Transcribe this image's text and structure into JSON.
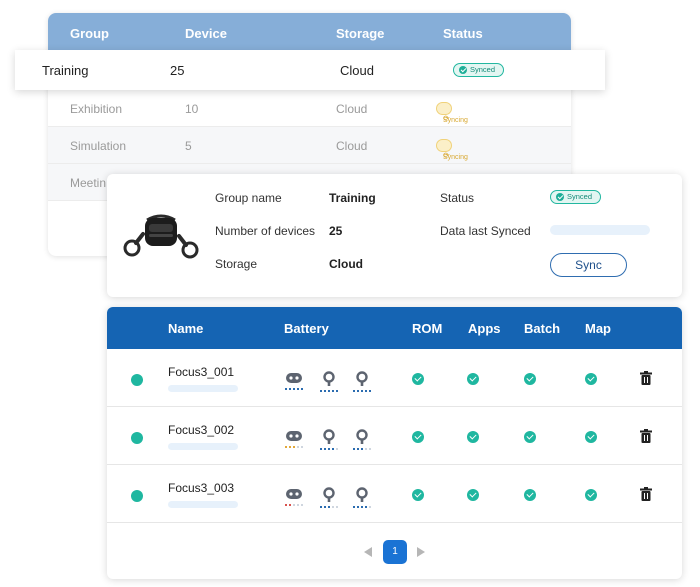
{
  "group_table": {
    "headers": [
      "Group",
      "Device",
      "Storage",
      "Status"
    ],
    "selected_row": {
      "group": "Training",
      "devices": "25",
      "storage": "Cloud",
      "status": "Synced"
    },
    "rows": [
      {
        "group": "Exhibition",
        "devices": "10",
        "storage": "Cloud",
        "status": "Syncing"
      },
      {
        "group": "Simulation",
        "devices": "5",
        "storage": "Cloud",
        "status": "Syncing"
      },
      {
        "group": "Meetin",
        "devices": "",
        "storage": "",
        "status": ""
      }
    ]
  },
  "group_detail": {
    "group_name_label": "Group name",
    "group_name": "Training",
    "devices_label": "Number of devices",
    "devices": "25",
    "storage_label": "Storage",
    "storage": "Cloud",
    "status_label": "Status",
    "status": "Synced",
    "last_synced_label": "Data last Synced",
    "sync_button": "Sync"
  },
  "device_table": {
    "headers": {
      "name": "Name",
      "battery": "Battery",
      "rom": "ROM",
      "apps": "Apps",
      "batch": "Batch",
      "map": "Map"
    },
    "rows": [
      {
        "name": "Focus3_001",
        "status": "online",
        "rom": "ok",
        "apps": "ok",
        "batch": "ok",
        "map": "ok"
      },
      {
        "name": "Focus3_002",
        "status": "online",
        "rom": "ok",
        "apps": "ok",
        "batch": "ok",
        "map": "ok"
      },
      {
        "name": "Focus3_003",
        "status": "online",
        "rom": "ok",
        "apps": "ok",
        "batch": "ok",
        "map": "ok"
      }
    ],
    "pagination": {
      "current_page": "1"
    }
  },
  "colors": {
    "header_dark": "#1564b3",
    "header_light": "#86aed8",
    "success": "#1fb7a0",
    "syncing": "#f0d27a"
  },
  "icons": [
    "vr-headset-icon",
    "headset-battery-icon",
    "controller-battery-icon",
    "check-icon",
    "trash-icon",
    "chevron-left-icon",
    "chevron-right-icon"
  ]
}
